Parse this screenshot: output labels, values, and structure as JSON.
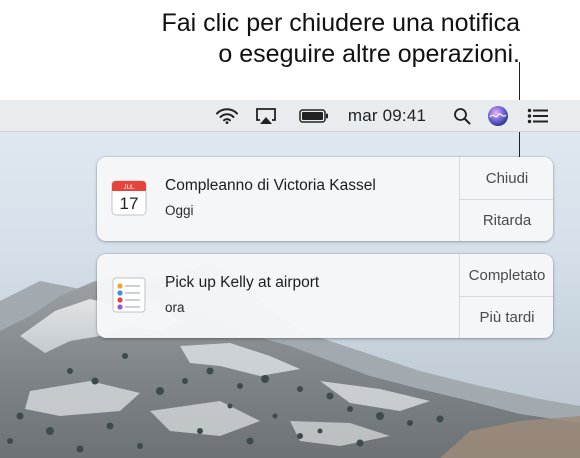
{
  "callout": {
    "line1": "Fai clic per chiudere una notifica",
    "line2": "o eseguire altre operazioni."
  },
  "menubar": {
    "clock": "mar 09:41",
    "icons": [
      "wifi-icon",
      "airplay-icon",
      "battery-icon",
      "search-icon",
      "siri-icon",
      "notification-center-icon"
    ]
  },
  "notifications": [
    {
      "app_icon": "calendar-icon",
      "calendar_month": "JUL",
      "calendar_day": "17",
      "title": "Compleanno di Victoria Kassel",
      "subtitle": "Oggi",
      "action_primary": "Chiudi",
      "action_secondary": "Ritarda"
    },
    {
      "app_icon": "reminders-icon",
      "title": "Pick up Kelly at airport",
      "subtitle": "ora",
      "action_primary": "Completato",
      "action_secondary": "Più tardi"
    }
  ]
}
